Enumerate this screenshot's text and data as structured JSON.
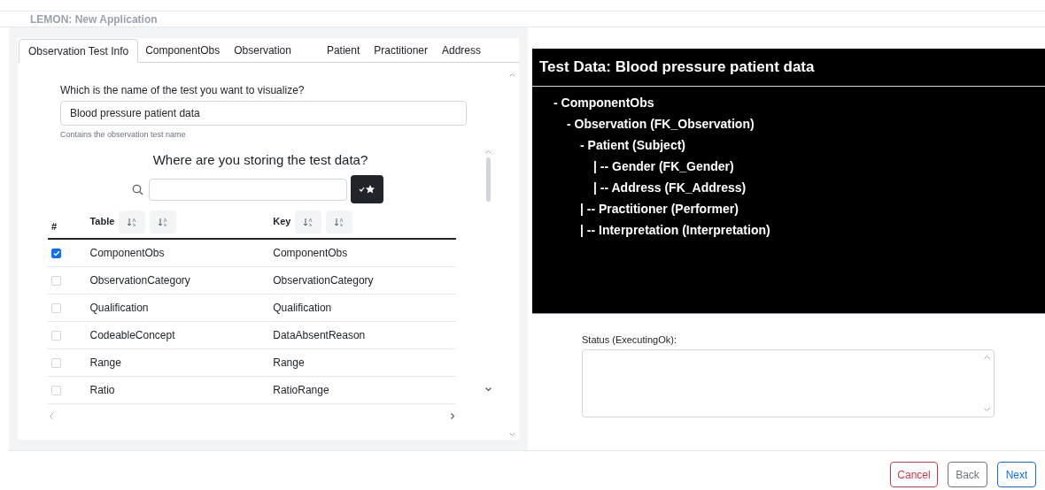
{
  "app_title": "LEMON: New Application",
  "tabs": [
    {
      "label": "Observation Test Info",
      "selected": true
    },
    {
      "label": "ComponentObs",
      "selected": false
    },
    {
      "label": "Observation",
      "selected": false
    },
    {
      "label": "Patient",
      "selected": false
    },
    {
      "label": "Practitioner",
      "selected": false
    },
    {
      "label": "Address",
      "selected": false
    }
  ],
  "test_name": {
    "label": "Which is the name of the test you want to visualize?",
    "value": "Blood pressure patient data",
    "help": "Contains the observation test name"
  },
  "storage": {
    "heading": "Where are you storing the test data?",
    "table": {
      "columns": [
        "#",
        "Table",
        "Key"
      ],
      "rows": [
        {
          "checked": true,
          "table": "ComponentObs",
          "key": "ComponentObs"
        },
        {
          "checked": false,
          "table": "ObservationCategory",
          "key": "ObservationCategory"
        },
        {
          "checked": false,
          "table": "Qualification",
          "key": "Qualification"
        },
        {
          "checked": false,
          "table": "CodeableConcept",
          "key": "DataAbsentReason"
        },
        {
          "checked": false,
          "table": "Range",
          "key": "Range"
        },
        {
          "checked": false,
          "table": "Ratio",
          "key": "RatioRange"
        }
      ]
    }
  },
  "preview": {
    "title": "Test Data: Blood pressure patient data",
    "tree": [
      {
        "text": "- ComponentObs",
        "children": [
          {
            "text": "- Observation (FK_Observation)",
            "children": [
              {
                "text": "- Patient (Subject)",
                "children": [
                  {
                    "text": "| -- Gender (FK_Gender)"
                  },
                  {
                    "text": "| -- Address (FK_Address)"
                  }
                ]
              },
              {
                "text": "| -- Practitioner (Performer)"
              },
              {
                "text": "| -- Interpretation (Interpretation)"
              }
            ]
          }
        ]
      }
    ]
  },
  "status": {
    "label": "Status (ExecutingOk):"
  },
  "buttons": [
    {
      "label": "Cancel",
      "kind": "danger"
    },
    {
      "label": "Back",
      "kind": "secondary"
    },
    {
      "label": "Next",
      "kind": "primary"
    }
  ]
}
